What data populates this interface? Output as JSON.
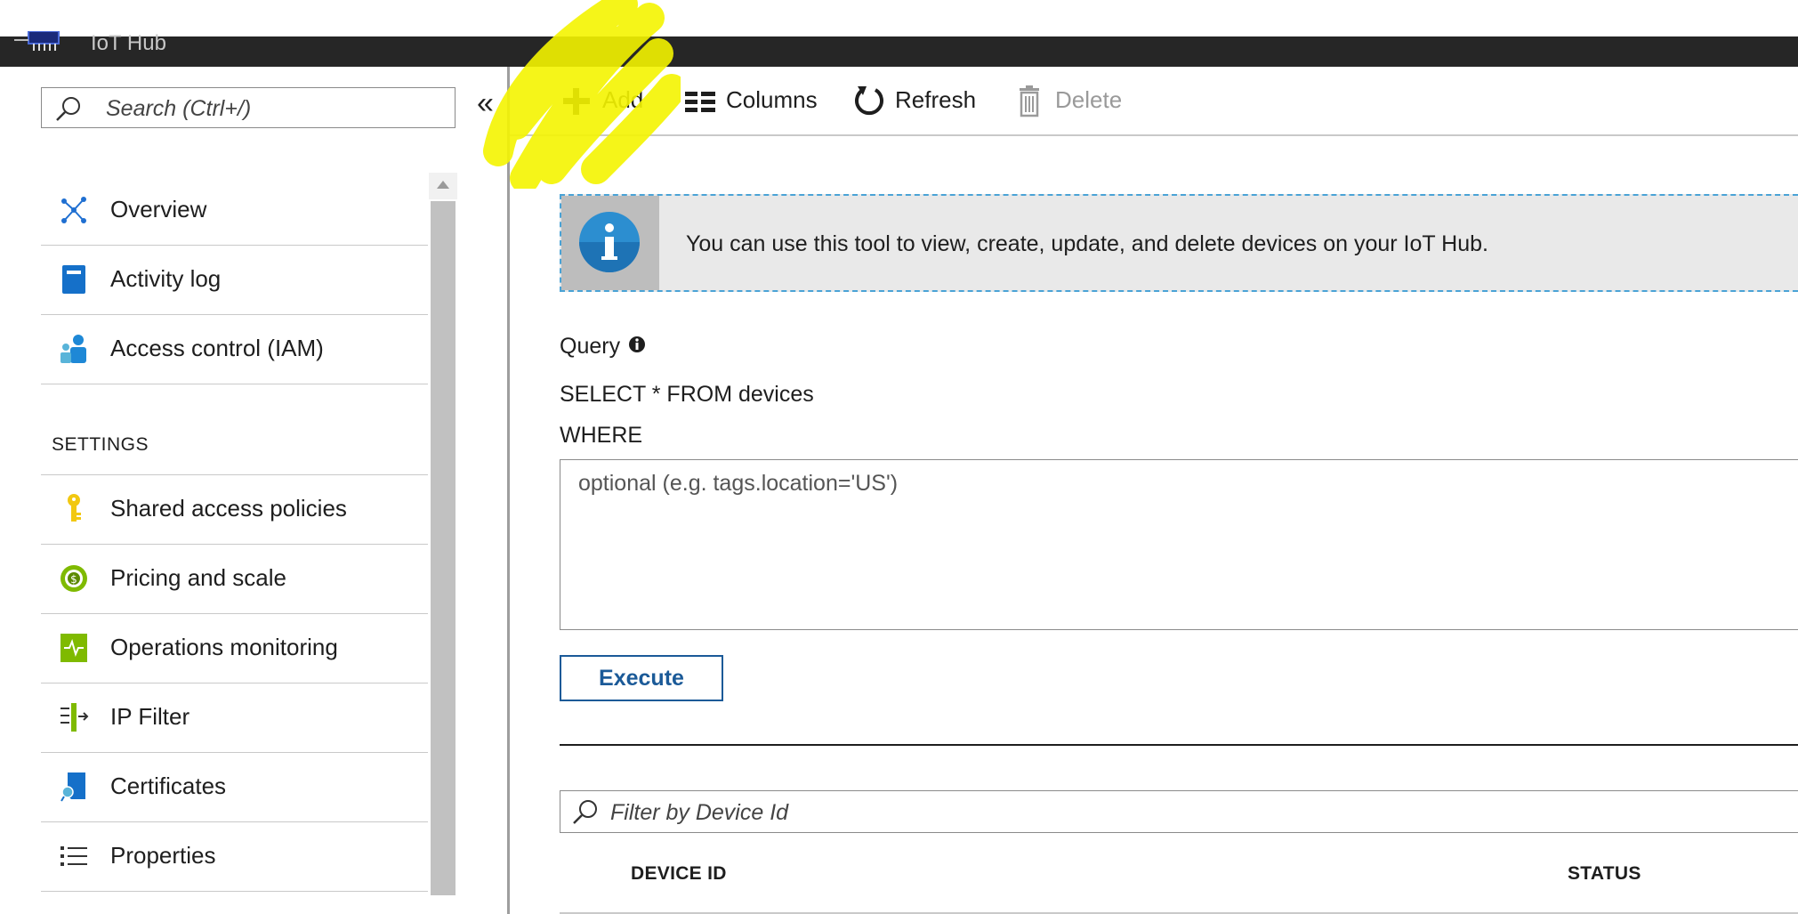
{
  "header": {
    "title": "IoT Hub"
  },
  "sidebar": {
    "search_placeholder": "Search (Ctrl+/)",
    "collapse_glyph": "«",
    "items": [
      {
        "label": "Overview",
        "icon": "overview-icon"
      },
      {
        "label": "Activity log",
        "icon": "activity-log-icon"
      },
      {
        "label": "Access control (IAM)",
        "icon": "access-control-icon"
      }
    ],
    "section_title": "SETTINGS",
    "settings_items": [
      {
        "label": "Shared access policies",
        "icon": "key-icon"
      },
      {
        "label": "Pricing and scale",
        "icon": "pricing-icon"
      },
      {
        "label": "Operations monitoring",
        "icon": "monitoring-icon"
      },
      {
        "label": "IP Filter",
        "icon": "ip-filter-icon"
      },
      {
        "label": "Certificates",
        "icon": "certificate-icon"
      },
      {
        "label": "Properties",
        "icon": "properties-icon"
      }
    ]
  },
  "toolbar": {
    "add_label": "Add",
    "columns_label": "Columns",
    "refresh_label": "Refresh",
    "delete_label": "Delete"
  },
  "main": {
    "info_text": "You can use this tool to view, create, update, and delete devices on your IoT Hub.",
    "query_label": "Query",
    "select_text": "SELECT * FROM devices",
    "where_label": "WHERE",
    "where_placeholder": "optional (e.g. tags.location='US')",
    "execute_label": "Execute",
    "filter_placeholder": "Filter by Device Id",
    "columns": [
      "DEVICE ID",
      "STATUS"
    ]
  },
  "colors": {
    "topbar": "#262626",
    "accent_blue": "#1b5a98",
    "info_border": "#4aa3d6",
    "highlight": "#f4f400"
  }
}
